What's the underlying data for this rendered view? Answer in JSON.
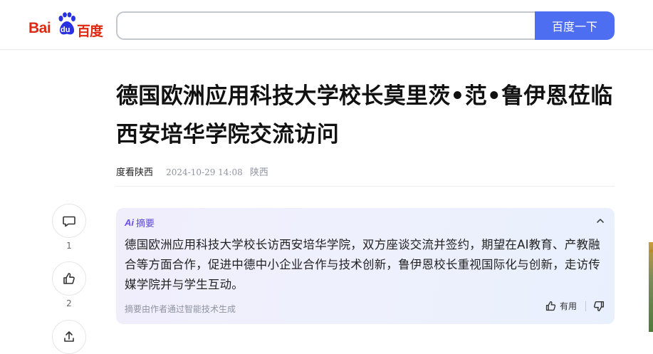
{
  "header": {
    "logo": {
      "latin_left": "Bai",
      "paw_text": "du",
      "chinese": "百度"
    },
    "search": {
      "value": "",
      "placeholder": ""
    },
    "search_button_label": "百度一下"
  },
  "article": {
    "title": "德国欧洲应用科技大学校长莫里茨•范•鲁伊恩莅临西安培华学院交流访问",
    "author": "度看陕西",
    "time": "2024-10-29 14:08",
    "location": "陕西"
  },
  "actions": {
    "comment": {
      "icon": "comment-icon",
      "count": "1"
    },
    "like": {
      "icon": "thumbs-up-icon",
      "count": "2"
    },
    "share": {
      "icon": "share-icon"
    }
  },
  "summary": {
    "badge_ai": "Ai",
    "badge_label": "摘要",
    "text": "德国欧洲应用科技大学校长访西安培华学院，双方座谈交流并签约，期望在AI教育、产教融合等方面合作，促进中德中小企业合作与技术创新，鲁伊恩校长重视国际化与创新，走访传媒学院并与学生互动。",
    "note": "摘要由作者通过智能技术生成",
    "useful_label": "有用"
  },
  "colors": {
    "brand_red": "#de2910",
    "brand_blue": "#2932e1",
    "search_button": "#4e6ef2",
    "ai_purple": "#6a4cf5"
  }
}
